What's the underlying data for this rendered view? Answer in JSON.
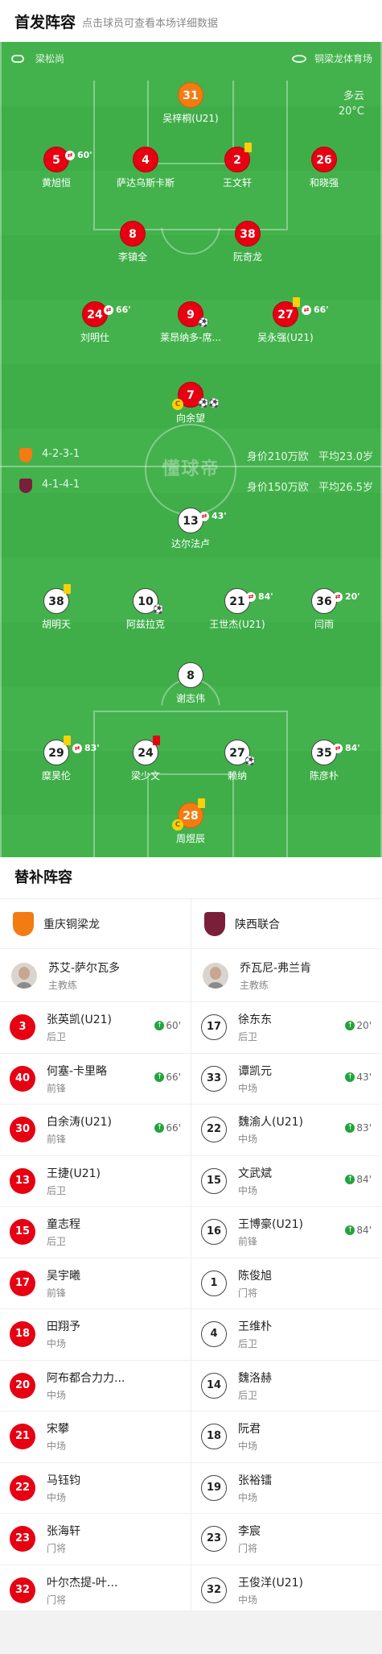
{
  "header": {
    "title": "首发阵容",
    "subtitle": "点击球员可查看本场详细数据"
  },
  "venue": {
    "referee": "梁松尚",
    "stadium": "铜梁龙体育场"
  },
  "weather": {
    "condition": "多云",
    "temp": "20°C"
  },
  "watermark": "懂球帝",
  "home": {
    "formation": "4-2-3-1",
    "value": "身价210万欧",
    "age": "平均23.0岁"
  },
  "away": {
    "formation": "4-1-4-1",
    "value": "身价150万欧",
    "age": "平均26.5岁"
  },
  "pitch_players": [
    {
      "id": "p1",
      "num": "31",
      "name": "吴梓桐(U21)",
      "gk": true
    },
    {
      "id": "p2",
      "num": "5",
      "name": "黄旭恒",
      "sub": "60'"
    },
    {
      "id": "p3",
      "num": "4",
      "name": "萨达乌斯卡斯"
    },
    {
      "id": "p4",
      "num": "2",
      "name": "王文轩",
      "yellow": true
    },
    {
      "id": "p5",
      "num": "26",
      "name": "和晓强"
    },
    {
      "id": "p6",
      "num": "8",
      "name": "李镇全"
    },
    {
      "id": "p7",
      "num": "38",
      "name": "阮奇龙"
    },
    {
      "id": "p8",
      "num": "24",
      "name": "刘明仕",
      "sub": "66'"
    },
    {
      "id": "p9",
      "num": "9",
      "name": "莱昂纳多-席...",
      "ball": "⚽"
    },
    {
      "id": "p10",
      "num": "27",
      "name": "吴永强(U21)",
      "yellow": true,
      "sub": "66'"
    },
    {
      "id": "p11",
      "num": "7",
      "name": "向余望",
      "captain": "C",
      "ball": "⚽⚽"
    },
    {
      "id": "a1",
      "num": "13",
      "name": "达尔法卢",
      "sub": "43'"
    },
    {
      "id": "a2",
      "num": "38",
      "name": "胡明天",
      "yellow": true
    },
    {
      "id": "a3",
      "num": "10",
      "name": "阿兹拉克",
      "ball": "⚽"
    },
    {
      "id": "a4",
      "num": "21",
      "name": "王世杰(U21)",
      "sub": "84'"
    },
    {
      "id": "a5",
      "num": "36",
      "name": "闫雨",
      "sub": "20'"
    },
    {
      "id": "a6",
      "num": "8",
      "name": "谢志伟"
    },
    {
      "id": "a7",
      "num": "29",
      "name": "糜昊伦",
      "yellow": true,
      "sub": "83'"
    },
    {
      "id": "a8",
      "num": "24",
      "name": "梁少文",
      "red": true
    },
    {
      "id": "a9",
      "num": "27",
      "name": "赖纳",
      "ball": "⚽"
    },
    {
      "id": "a10",
      "num": "35",
      "name": "陈彦朴",
      "sub": "84'"
    },
    {
      "id": "a11",
      "num": "28",
      "name": "周煜辰",
      "gk": true,
      "captain": "C",
      "yellow": true
    }
  ],
  "subs_section": {
    "title": "替补阵容",
    "home_team": "重庆铜梁龙",
    "away_team": "陕西联合",
    "coach_role": "主教练",
    "home_coach": "苏艾-萨尔瓦多",
    "away_coach": "乔瓦尼-弗兰肯",
    "home_subs": [
      {
        "num": "3",
        "name": "张英凯(U21)",
        "pos": "后卫",
        "on": "60'"
      },
      {
        "num": "40",
        "name": "何塞-卡里略",
        "pos": "前锋",
        "on": "66'"
      },
      {
        "num": "30",
        "name": "白余涛(U21)",
        "pos": "前锋",
        "on": "66'"
      },
      {
        "num": "13",
        "name": "王捷(U21)",
        "pos": "后卫"
      },
      {
        "num": "15",
        "name": "童志程",
        "pos": "后卫"
      },
      {
        "num": "17",
        "name": "吴宇曦",
        "pos": "前锋"
      },
      {
        "num": "18",
        "name": "田翔予",
        "pos": "中场"
      },
      {
        "num": "20",
        "name": "阿布都合力力...",
        "pos": "中场"
      },
      {
        "num": "21",
        "name": "宋攀",
        "pos": "中场"
      },
      {
        "num": "22",
        "name": "马钰钧",
        "pos": "中场"
      },
      {
        "num": "23",
        "name": "张海轩",
        "pos": "门将"
      },
      {
        "num": "32",
        "name": "叶尔杰提-叶...",
        "pos": "门将"
      }
    ],
    "away_subs": [
      {
        "num": "17",
        "name": "徐东东",
        "pos": "后卫",
        "on": "20'"
      },
      {
        "num": "33",
        "name": "谭凯元",
        "pos": "中场",
        "on": "43'"
      },
      {
        "num": "22",
        "name": "魏渝人(U21)",
        "pos": "中场",
        "on": "83'"
      },
      {
        "num": "15",
        "name": "文武斌",
        "pos": "中场",
        "on": "84'"
      },
      {
        "num": "16",
        "name": "王博豪(U21)",
        "pos": "前锋",
        "on": "84'"
      },
      {
        "num": "1",
        "name": "陈俊旭",
        "pos": "门将"
      },
      {
        "num": "4",
        "name": "王维朴",
        "pos": "后卫"
      },
      {
        "num": "14",
        "name": "魏洛赫",
        "pos": "后卫"
      },
      {
        "num": "18",
        "name": "阮君",
        "pos": "中场"
      },
      {
        "num": "19",
        "name": "张裕镭",
        "pos": "中场"
      },
      {
        "num": "23",
        "name": "李宸",
        "pos": "门将"
      },
      {
        "num": "32",
        "name": "王俊洋(U21)",
        "pos": "中场"
      }
    ]
  },
  "colors": {
    "pitch": "#3fae49",
    "home_player": "#e60012",
    "goalkeeper": "#f37b13",
    "away_player": "#ffffff",
    "sub_up": "#23a33c"
  }
}
